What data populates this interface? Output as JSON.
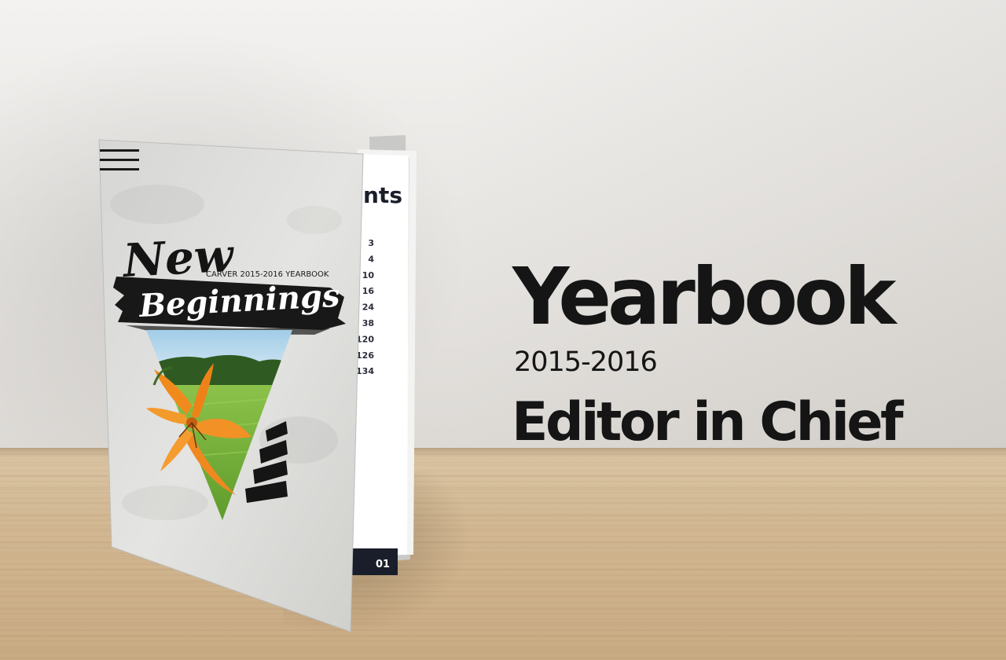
{
  "headline": "Yearbook",
  "years": "2015-2016",
  "role": "Editor in Chief",
  "cover": {
    "title_line1": "New",
    "title_line2": "Beginnings",
    "subtitle": "CARVER 2015-2016 YEARBOOK"
  },
  "inner_page": {
    "heading_fragment": "nts",
    "toc_numbers": [
      "3",
      "4",
      "10",
      "16",
      "24",
      "38",
      "120",
      "126",
      "134"
    ],
    "page_number": "01"
  },
  "colors": {
    "text": "#151515",
    "flower": "#f08a1c",
    "grass": "#7db43a",
    "sky": "#9fcbe8"
  }
}
